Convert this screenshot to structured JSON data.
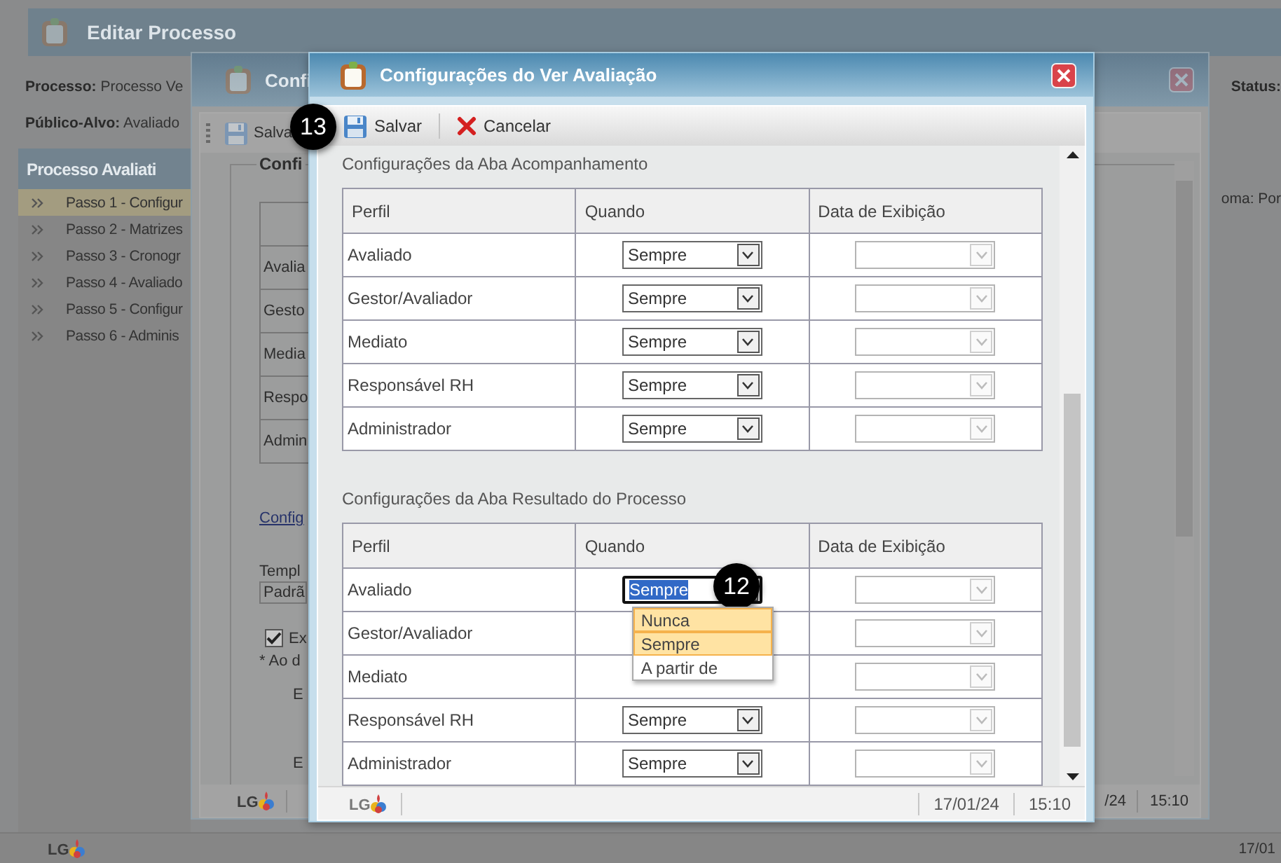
{
  "page": {
    "title": "Editar Processo",
    "fields": [
      {
        "label": "Processo:",
        "value": "Processo Ve"
      },
      {
        "label": "Público-Alvo:",
        "value": "Avaliado"
      }
    ],
    "status_label": "Status:",
    "sidebar": {
      "title": "Processo Avaliati",
      "items": [
        {
          "label": "Passo 1 - Configur",
          "selected": true
        },
        {
          "label": "Passo 2 - Matrizes",
          "selected": false
        },
        {
          "label": "Passo 3 - Cronogr",
          "selected": false
        },
        {
          "label": "Passo 4 - Avaliado",
          "selected": false
        },
        {
          "label": "Passo 5 - Configur",
          "selected": false
        },
        {
          "label": "Passo 6 - Adminis",
          "selected": false
        }
      ]
    },
    "language_field": {
      "label": "oma:",
      "value": "Por"
    },
    "footer": {
      "logo": "LG",
      "date": "17/01"
    }
  },
  "back_dialog": {
    "title": "Confi",
    "toolbar_button": "Salva",
    "legend": "Confi",
    "rows": [
      "Avalia",
      "Gesto",
      "Media",
      "Respo",
      "Admin"
    ],
    "link": "Config",
    "template_label": "Templ",
    "template_value": "Padrã",
    "checkbox": {
      "label": "Ex",
      "checked": true
    },
    "note": "* Ao d",
    "labels": [
      "E",
      "E"
    ],
    "footer": {
      "logo": "LG",
      "date": "/24",
      "time": "15:10"
    }
  },
  "dialog": {
    "title": "Configurações do Ver Avaliação",
    "toolbar": [
      {
        "label": "Salvar",
        "kind": "save"
      },
      {
        "label": "Cancelar",
        "kind": "cancel"
      }
    ],
    "sections": [
      {
        "title": "Configurações da Aba Acompanhamento",
        "columns": [
          "Perfil",
          "Quando",
          "Data de Exibição"
        ],
        "rows": [
          {
            "perfil": "Avaliado",
            "quando": "Sempre",
            "focused": false,
            "date_disabled": true
          },
          {
            "perfil": "Gestor/Avaliador",
            "quando": "Sempre",
            "focused": false,
            "date_disabled": true
          },
          {
            "perfil": "Mediato",
            "quando": "Sempre",
            "focused": false,
            "date_disabled": true
          },
          {
            "perfil": "Responsável RH",
            "quando": "Sempre",
            "focused": false,
            "date_disabled": true
          },
          {
            "perfil": "Administrador",
            "quando": "Sempre",
            "focused": false,
            "date_disabled": true
          }
        ]
      },
      {
        "title": "Configurações da Aba Resultado do Processo",
        "columns": [
          "Perfil",
          "Quando",
          "Data de Exibição"
        ],
        "rows": [
          {
            "perfil": "Avaliado",
            "quando": "Sempre",
            "focused": true,
            "date_disabled": true,
            "options": [
              {
                "label": "Nunca",
                "highlighted": true
              },
              {
                "label": "Sempre",
                "highlighted": true
              },
              {
                "label": "A partir de",
                "highlighted": false
              }
            ]
          },
          {
            "perfil": "Gestor/Avaliador",
            "date_disabled": true
          },
          {
            "perfil": "Mediato",
            "date_disabled": true
          },
          {
            "perfil": "Responsável RH",
            "quando": "Sempre",
            "focused": false,
            "date_disabled": true
          },
          {
            "perfil": "Administrador",
            "quando": "Sempre",
            "focused": false,
            "date_disabled": true
          }
        ]
      }
    ],
    "footer": {
      "logo": "LG",
      "date": "17/01/24",
      "time": "15:10"
    }
  },
  "callouts": [
    {
      "label": "13"
    },
    {
      "label": "12"
    }
  ]
}
